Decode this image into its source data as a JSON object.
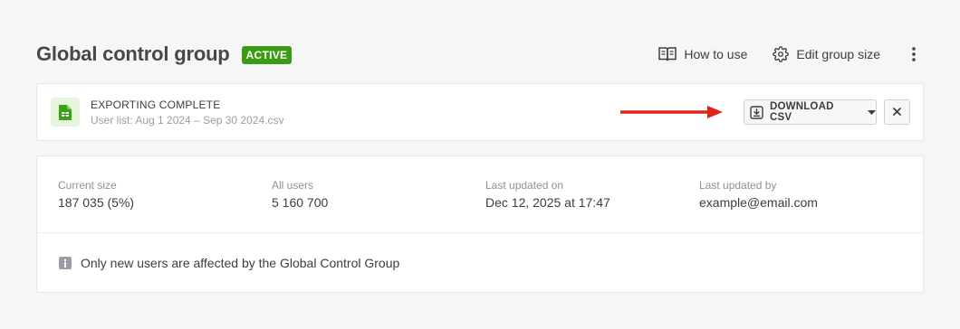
{
  "header": {
    "title": "Global control group",
    "status_badge": "ACTIVE",
    "how_to_use_label": "How to use",
    "edit_group_size_label": "Edit group size"
  },
  "export": {
    "status": "EXPORTING COMPLETE",
    "filename": "User list: Aug 1 2024 – Sep 30 2024.csv",
    "download_label": "DOWNLOAD CSV"
  },
  "stats": {
    "current_size": {
      "label": "Current size",
      "value": "187 035 (5%)"
    },
    "all_users": {
      "label": "All users",
      "value": "5 160 700"
    },
    "last_updated_on": {
      "label": "Last updated on",
      "value": "Dec 12, 2025 at 17:47"
    },
    "last_updated_by": {
      "label": "Last updated by",
      "value": "example@email.com"
    }
  },
  "info": {
    "message": "Only new users are affected by the Global Control Group"
  },
  "colors": {
    "active_badge": "#3a9c12",
    "arrow": "#e0231a",
    "file_icon": "#3aa11d",
    "file_icon_bg": "#e6f5dc"
  },
  "icons": [
    "book-icon",
    "gear-icon",
    "more-vertical-icon",
    "spreadsheet-file-icon",
    "arrow-right-icon",
    "download-icon",
    "chevron-down-icon",
    "close-icon",
    "info-icon"
  ]
}
